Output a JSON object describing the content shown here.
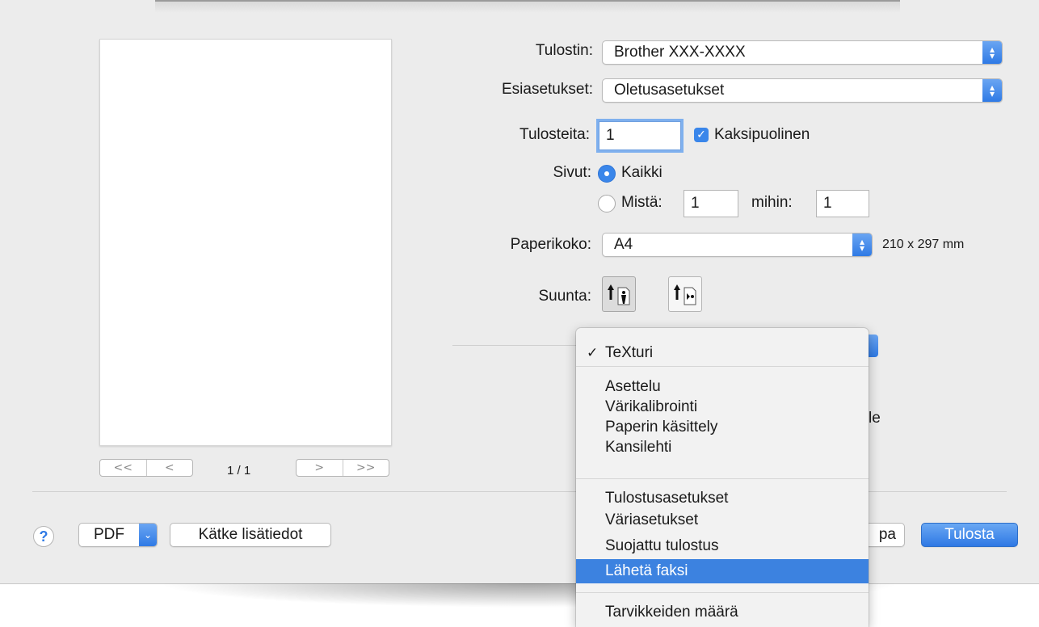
{
  "printer": {
    "label": "Tulostin:",
    "value": "Brother XXX-XXXX"
  },
  "presets": {
    "label": "Esiasetukset:",
    "value": "Oletusasetukset"
  },
  "copies": {
    "label": "Tulosteita:",
    "value": "1",
    "duplex_label": "Kaksipuolinen",
    "duplex_checked": true
  },
  "pages": {
    "label": "Sivut:",
    "all_label": "Kaikki",
    "from_label": "Mistä:",
    "from_value": "1",
    "to_label": "mihin:",
    "to_value": "1",
    "selected": "all"
  },
  "paper": {
    "label": "Paperikoko:",
    "value": "A4",
    "size_text": "210 x 297 mm"
  },
  "orientation": {
    "label": "Suunta:",
    "selected": "portrait"
  },
  "preview": {
    "page_indicator": "1 / 1",
    "first": "<<",
    "prev": "<",
    "next": ">",
    "last": ">>"
  },
  "background": {
    "partial_text": "le",
    "partial_button": "pa"
  },
  "footer": {
    "help": "?",
    "pdf_label": "PDF",
    "hide_details_label": "Kätke lisätiedot",
    "print_label": "Tulosta"
  },
  "menu": {
    "checked_item": "TeXturi",
    "group1": [
      "Asettelu",
      "Värikalibrointi",
      "Paperin käsittely",
      "Kansilehti"
    ],
    "group2": [
      "Tulostusasetukset",
      "Väriasetukset",
      "Suojattu tulostus",
      "Lähetä faksi"
    ],
    "group3": [
      "Tarvikkeiden määrä"
    ],
    "highlighted": "Lähetä faksi"
  },
  "colors": {
    "accent": "#3a86ea",
    "highlight": "#3c82e0",
    "sheet_bg": "#ececec"
  }
}
